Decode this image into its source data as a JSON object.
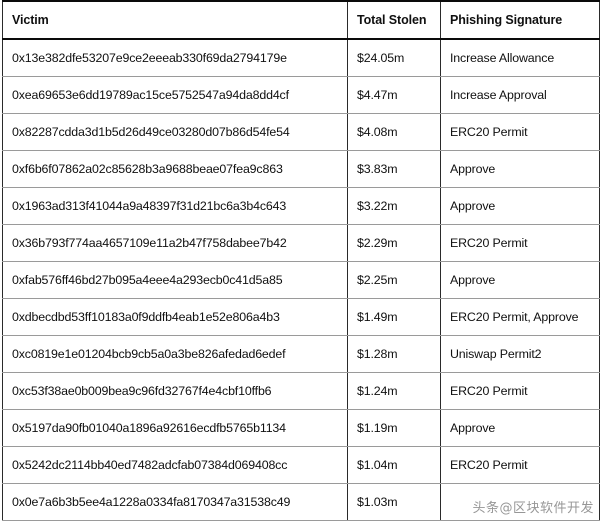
{
  "table": {
    "columns": [
      "Victim",
      "Total Stolen",
      "Phishing Signature"
    ],
    "rows": [
      {
        "victim": "0x13e382dfe53207e9ce2eeeab330f69da2794179e",
        "total_stolen": "$24.05m",
        "phishing_signature": "Increase Allowance"
      },
      {
        "victim": "0xea69653e6dd19789ac15ce5752547a94da8dd4cf",
        "total_stolen": "$4.47m",
        "phishing_signature": "Increase Approval"
      },
      {
        "victim": "0x82287cdda3d1b5d26d49ce03280d07b86d54fe54",
        "total_stolen": "$4.08m",
        "phishing_signature": "ERC20 Permit"
      },
      {
        "victim": "0xf6b6f07862a02c85628b3a9688beae07fea9c863",
        "total_stolen": "$3.83m",
        "phishing_signature": "Approve"
      },
      {
        "victim": "0x1963ad313f41044a9a48397f31d21bc6a3b4c643",
        "total_stolen": "$3.22m",
        "phishing_signature": "Approve"
      },
      {
        "victim": "0x36b793f774aa4657109e11a2b47f758dabee7b42",
        "total_stolen": "$2.29m",
        "phishing_signature": "ERC20 Permit"
      },
      {
        "victim": "0xfab576ff46bd27b095a4eee4a293ecb0c41d5a85",
        "total_stolen": "$2.25m",
        "phishing_signature": "Approve"
      },
      {
        "victim": "0xdbecdbd53ff10183a0f9ddfb4eab1e52e806a4b3",
        "total_stolen": "$1.49m",
        "phishing_signature": "ERC20 Permit, Approve"
      },
      {
        "victim": "0xc0819e1e01204bcb9cb5a0a3be826afedad6edef",
        "total_stolen": "$1.28m",
        "phishing_signature": "Uniswap Permit2"
      },
      {
        "victim": "0xc53f38ae0b009bea9c96fd32767f4e4cbf10ffb6",
        "total_stolen": "$1.24m",
        "phishing_signature": "ERC20 Permit"
      },
      {
        "victim": "0x5197da90fb01040a1896a92616ecdfb5765b1134",
        "total_stolen": "$1.19m",
        "phishing_signature": "Approve"
      },
      {
        "victim": "0x5242dc2114bb40ed7482adcfab07384d069408cc",
        "total_stolen": "$1.04m",
        "phishing_signature": "ERC20 Permit"
      },
      {
        "victim": "0x0e7a6b3b5ee4a1228a0334fa8170347a31538c49",
        "total_stolen": "$1.03m",
        "phishing_signature": ""
      }
    ]
  },
  "watermark": {
    "text": "头条@区块软件开发"
  }
}
